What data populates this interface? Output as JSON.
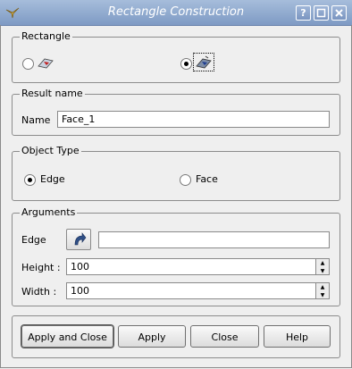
{
  "window": {
    "title": "Rectangle Construction"
  },
  "rectangle_group": {
    "legend": "Rectangle"
  },
  "result_group": {
    "legend": "Result name",
    "name_label": "Name",
    "name_value": "Face_1"
  },
  "object_type_group": {
    "legend": "Object Type",
    "edge_label": "Edge",
    "face_label": "Face"
  },
  "arguments_group": {
    "legend": "Arguments",
    "edge_label": "Edge",
    "edge_value": "",
    "height_label": "Height :",
    "height_value": "100",
    "width_label": "Width :",
    "width_value": "100"
  },
  "buttons": {
    "apply_close": "Apply and Close",
    "apply": "Apply",
    "close": "Close",
    "help": "Help"
  },
  "colors": {
    "titlebar": "#8aa4cc",
    "background": "#efefef"
  }
}
